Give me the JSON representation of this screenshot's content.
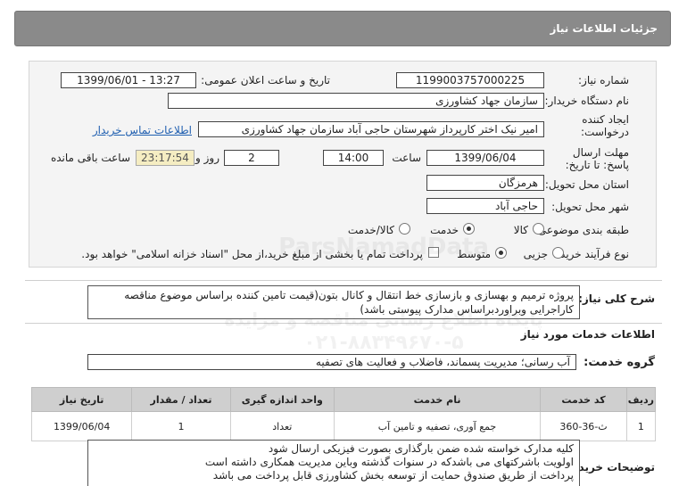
{
  "header": {
    "title": "جزئیات اطلاعات نیاز"
  },
  "form": {
    "need_number_label": "شماره نیاز:",
    "need_number": "1199003757000225",
    "announce_label": "تاریخ و ساعت اعلان عمومی:",
    "announce_value": "1399/06/01 - 13:27",
    "buyer_label": "نام دستگاه خریدار:",
    "buyer_value": "سازمان جهاد کشاورزی",
    "creator_label": "ایجاد کننده درخواست:",
    "creator_value": "امیر نیک اختر کارپرداز شهرستان حاجی آباد سازمان جهاد کشاورزی",
    "contact_link": "اطلاعات تماس خریدار",
    "deadline_label": "مهلت ارسال پاسخ: تا تاریخ:",
    "deadline_date": "1399/06/04",
    "time_label": "ساعت",
    "deadline_time": "14:00",
    "days_value": "2",
    "days_label": "روز و",
    "timer_value": "23:17:54",
    "remaining_label": "ساعت باقی مانده",
    "province_label": "استان محل تحویل:",
    "province_value": "هرمزگان",
    "city_label": "شهر محل تحویل:",
    "city_value": "حاجی آباد",
    "category_label": "طبقه بندی موضوعی:",
    "category_options": [
      "کالا",
      "خدمت",
      "کالا/خدمت"
    ],
    "category_selected": "خدمت",
    "process_label": "نوع فرآیند خرید :",
    "process_options": [
      "جزیی",
      "متوسط"
    ],
    "process_selected": "متوسط",
    "payment_note": "پرداخت تمام یا بخشی از مبلغ خرید،از محل \"اسناد خزانه اسلامی\" خواهد بود."
  },
  "description": {
    "label": "شرح کلی نیاز:",
    "text": "پروژه ترمیم و بهسازی و بازسازی خط انتقال و کانال بتون(قیمت تامین کننده براساس موضوع مناقصه کاراجرایی وبراوردبراساس مدارک پیوستی باشد)"
  },
  "services": {
    "section_title": "اطلاعات خدمات مورد نیاز",
    "group_label": "گروه خدمت:",
    "group_value": "آب رسانی؛ مدیریت پسماند، فاضلاب و فعالیت های تصفیه"
  },
  "table": {
    "headers": [
      "ردیف",
      "کد خدمت",
      "نام خدمت",
      "واحد اندازه گیری",
      "تعداد / مقدار",
      "تاریخ نیاز"
    ],
    "rows": [
      [
        "1",
        "ث-36-360",
        "جمع آوری، تصفیه و تامین آب",
        "تعداد",
        "1",
        "1399/06/04"
      ]
    ]
  },
  "buyer_notes": {
    "label": "توضیحات خریدار:",
    "lines": [
      "کلیه مدارک خواسته شده ضمن بارگذاری بصورت فیزیکی ارسال شود",
      "اولویت باشرکتهای می باشدکه در سنوات گذشته  وباین مدیریت همکاری داشته است",
      "پرداخت از طریق صندوق حمایت از توسعه بخش کشاورزی قابل پرداخت می باشد"
    ]
  },
  "watermark": {
    "lines": [
      "ParsNamadData",
      "پایگاه اطلاع رسانی مناقصه و مزایده",
      "۰۲۱-۸۸۳۴۹۶۷۰-۵"
    ]
  }
}
